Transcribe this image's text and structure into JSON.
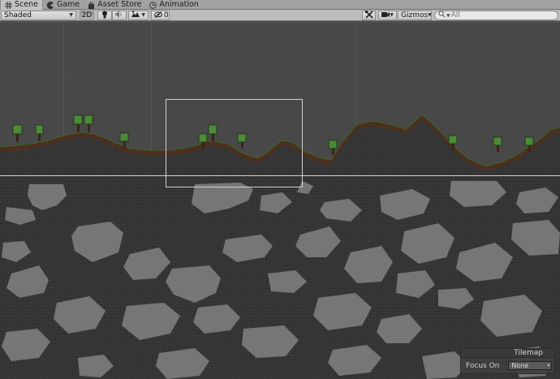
{
  "tabs": [
    {
      "label": "Scene",
      "icon": "grid-icon",
      "active": true
    },
    {
      "label": "Game",
      "icon": "pacman-icon",
      "active": false
    },
    {
      "label": "Asset Store",
      "icon": "store-bag-icon",
      "active": false
    },
    {
      "label": "Animation",
      "icon": "animation-clock-icon",
      "active": false
    }
  ],
  "toolbar": {
    "shading_mode": "Shaded",
    "mode_2d": "2D",
    "hidden_count": "0",
    "gizmos_label": "Gizmos",
    "search_placeholder": "All"
  },
  "tilemap_panel": {
    "title": "Tilemap",
    "focus_label": "Focus On",
    "focus_value": "None"
  },
  "colors": {
    "background": "#484848",
    "stone_dark": "#363636",
    "stone_light": "#7a7a7a",
    "dirt": "#4b2f1f",
    "grass": "#3a6b2a",
    "tree_leaves": "#4c8a3a"
  }
}
